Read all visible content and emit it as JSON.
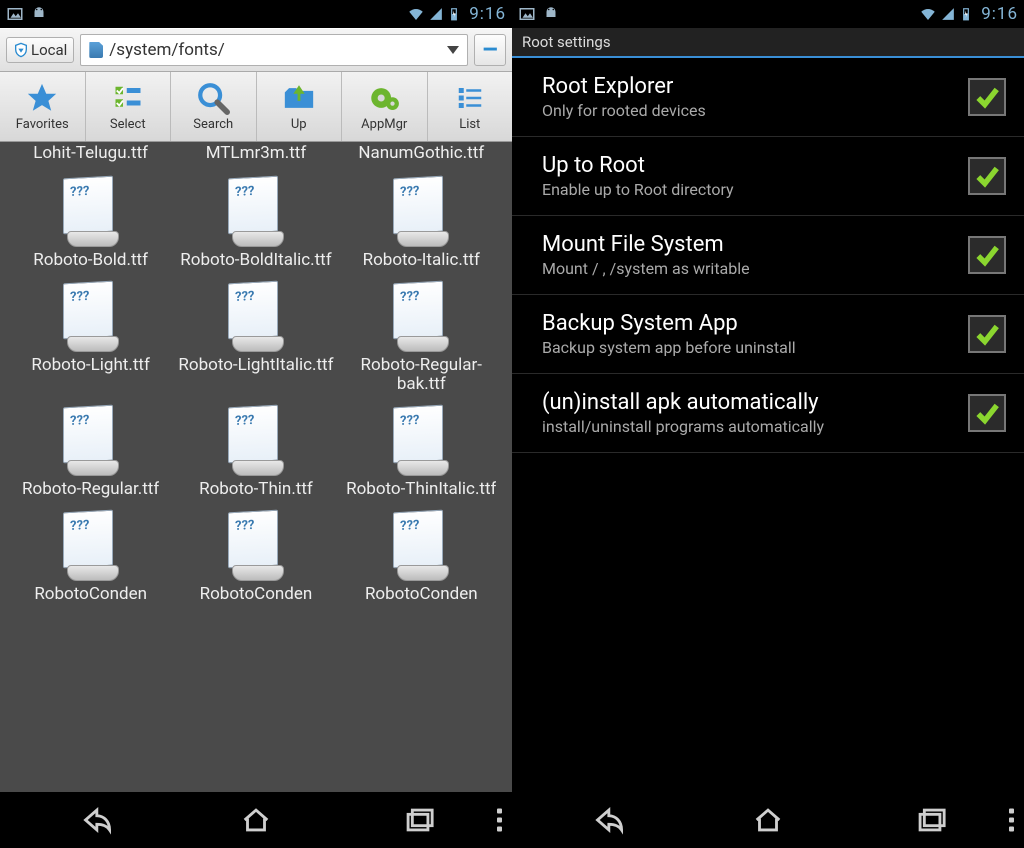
{
  "statusbar": {
    "clock": "9:16"
  },
  "left": {
    "local_label": "Local",
    "path": "/system/fonts/",
    "toolbar": {
      "favorites": "Favorites",
      "select": "Select",
      "search": "Search",
      "up": "Up",
      "appmgr": "AppMgr",
      "list": "List"
    },
    "head_row": [
      "Lohit-Telugu.ttf",
      "MTLmr3m.ttf",
      "NanumGothic.ttf"
    ],
    "files": [
      "Roboto-Bold.ttf",
      "Roboto-BoldItalic.ttf",
      "Roboto-Italic.ttf",
      "Roboto-Light.ttf",
      "Roboto-LightItalic.ttf",
      "Roboto-Regular-bak.ttf",
      "Roboto-Regular.ttf",
      "Roboto-Thin.ttf",
      "Roboto-ThinItalic.ttf",
      "RobotoConden",
      "RobotoConden",
      "RobotoConden"
    ]
  },
  "right": {
    "header": "Root settings",
    "items": [
      {
        "title": "Root Explorer",
        "sub": "Only for rooted devices",
        "checked": true
      },
      {
        "title": "Up to Root",
        "sub": "Enable up to Root directory",
        "checked": true
      },
      {
        "title": "Mount File System",
        "sub": "Mount / , /system as writable",
        "checked": true
      },
      {
        "title": "Backup System App",
        "sub": "Backup system app before uninstall",
        "checked": true
      },
      {
        "title": "(un)install apk automatically",
        "sub": "install/uninstall programs automatically",
        "checked": true
      }
    ]
  }
}
